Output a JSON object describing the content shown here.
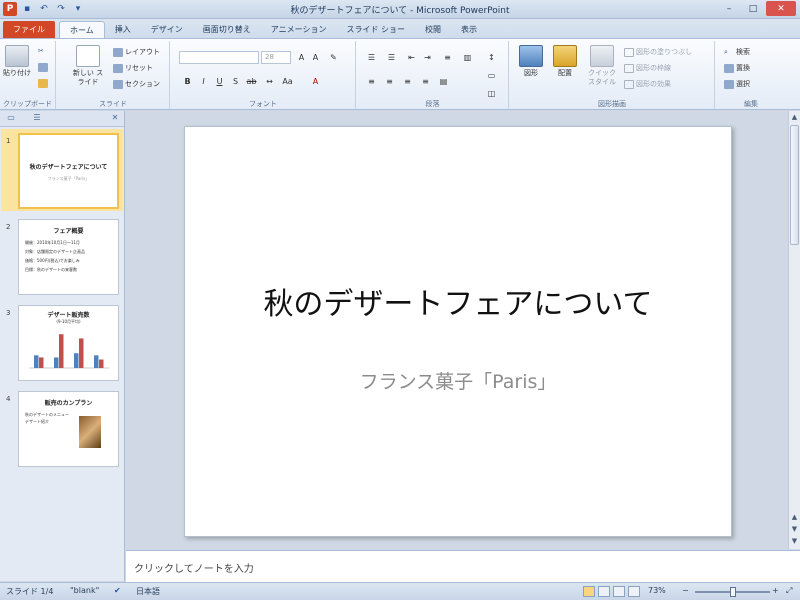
{
  "window": {
    "title": "秋のデザートフェアについて - Microsoft PowerPoint"
  },
  "quick_access": {
    "app_icon": "P",
    "save_icon": "save-icon",
    "undo_icon": "undo-icon",
    "redo_icon": "redo-icon"
  },
  "window_controls": {
    "minimize": "–",
    "maximize": "□",
    "close": "✕"
  },
  "tabs": [
    {
      "label": "ファイル"
    },
    {
      "label": "ホーム"
    },
    {
      "label": "挿入"
    },
    {
      "label": "デザイン"
    },
    {
      "label": "画面切り替え"
    },
    {
      "label": "アニメーション"
    },
    {
      "label": "スライド ショー"
    },
    {
      "label": "校閲"
    },
    {
      "label": "表示"
    }
  ],
  "ribbon": {
    "clipboard": {
      "label": "クリップボード",
      "paste": "貼り付け"
    },
    "slides": {
      "label": "スライド",
      "new_slide": "新しい スライド",
      "layout": "レイアウト",
      "reset": "リセット",
      "section": "セクション"
    },
    "font": {
      "label": "フォント",
      "size": "28"
    },
    "paragraph": {
      "label": "段落"
    },
    "drawing": {
      "label": "図形描画",
      "shapes": "図形",
      "arrange": "配置",
      "quick_styles": "クイック スタイル",
      "fill": "図形の塗りつぶし",
      "outline": "図形の枠線",
      "effects": "図形の効果"
    },
    "editing": {
      "label": "編集",
      "find": "検索",
      "replace": "置換",
      "select": "選択"
    }
  },
  "slides": [
    {
      "num": "1",
      "title": "秋のデザートフェアについて",
      "sub": "フランス菓子「Paris」"
    },
    {
      "num": "2",
      "title": "フェア概要",
      "bullets": [
        "開催：2010年10月1日～11月",
        "対象：店舗限定のデザート企画品",
        "価格：500円(税込)でお楽しみ",
        "目標：秋のデザートの来客数"
      ]
    },
    {
      "num": "3",
      "title": "デザート販売数",
      "sub": "(9-10月平均)"
    },
    {
      "num": "4",
      "title": "販売のカンプラン",
      "bullets": [
        "秋のデザートのメニュー",
        "デザート紹介"
      ]
    }
  ],
  "chart_data": {
    "type": "bar",
    "categories": [
      "A",
      "B",
      "C",
      "D"
    ],
    "series": [
      {
        "values": [
          3,
          2.5,
          3.5,
          3
        ]
      },
      {
        "values": [
          2.5,
          8,
          7,
          2
        ]
      }
    ],
    "colors": [
      "#4f81bd",
      "#c0504d"
    ],
    "ylim": [
      0,
      9
    ]
  },
  "current_slide": {
    "title": "秋のデザートフェアについて",
    "subtitle": "フランス菓子「Paris」"
  },
  "notes": {
    "placeholder": "クリックしてノートを入力"
  },
  "status": {
    "slide": "スライド 1/4",
    "theme": "\"blank\"",
    "language": "日本語",
    "zoom": "73%",
    "zoom_fraction": 0.5
  }
}
